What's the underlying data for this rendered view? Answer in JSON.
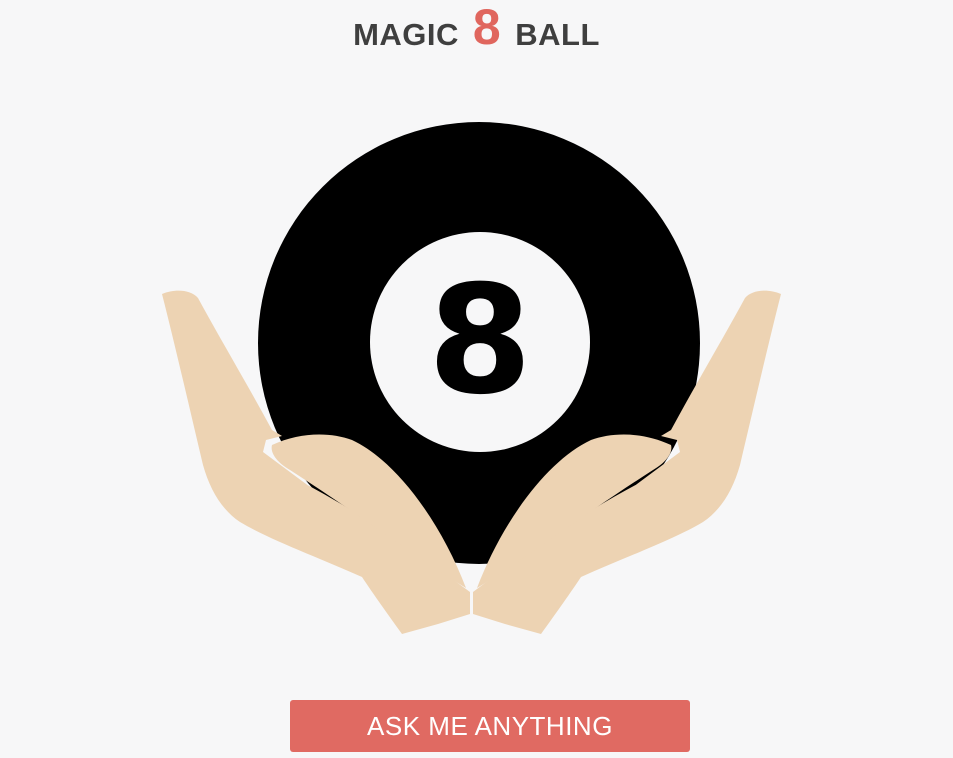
{
  "header": {
    "title_part1": "MAGIC",
    "title_number": "8",
    "title_part2": "BALL"
  },
  "ball": {
    "number": "8",
    "icon": "eight-ball-icon",
    "hands_icon": "cupped-hands-icon"
  },
  "actions": {
    "ask_label": "ASK ME ANYTHING"
  },
  "colors": {
    "background": "#f7f7f8",
    "accent": "#e06a62",
    "ball": "#000000",
    "skin": "#edd3b3",
    "title_text": "#3f3f3f"
  }
}
